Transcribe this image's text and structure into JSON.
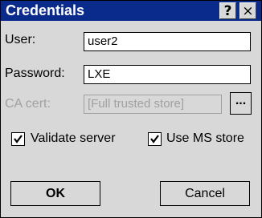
{
  "dialog": {
    "title": "Credentials"
  },
  "titlebar": {
    "help_label": "?",
    "close_label": "×"
  },
  "fields": {
    "user": {
      "label": "User:",
      "value": "user2"
    },
    "password": {
      "label": "Password:",
      "value": "LXE"
    },
    "ca_cert": {
      "label": "CA cert:",
      "value": "[Full trusted store]",
      "browse_label": "...",
      "enabled": false
    }
  },
  "checkboxes": {
    "validate_server": {
      "label": "Validate server",
      "checked": true
    },
    "use_ms_store": {
      "label": "Use MS store",
      "checked": true
    }
  },
  "buttons": {
    "ok": "OK",
    "cancel": "Cancel"
  }
}
